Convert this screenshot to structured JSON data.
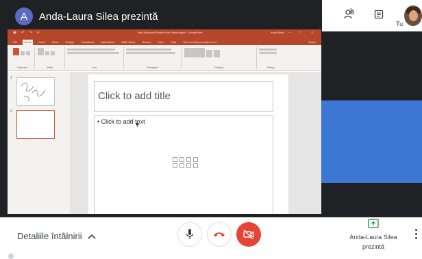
{
  "presenter": {
    "avatar_letter": "A",
    "title": "Anda-Laura Silea prezintă",
    "avatar_color": "#5c6bc0"
  },
  "top_right": {
    "people_count": "3",
    "you_label": "Tu",
    "icons": [
      "people-icon",
      "chat-icon"
    ]
  },
  "powerpoint": {
    "window_title": "New Microsoft PowerPoint Presentation - PowerPoint",
    "user": "Anda Silea",
    "tabs": [
      "File",
      "Home",
      "Insert",
      "Draw",
      "Design",
      "Transitions",
      "Animations",
      "Slide Show",
      "Review",
      "View",
      "Help",
      "Tell me what you want to do"
    ],
    "share_label": "Share",
    "ribbon_groups": [
      "Clipboard",
      "Slides",
      "Font",
      "Paragraph",
      "Drawing",
      "Editing"
    ],
    "thumbnails": [
      {
        "number": "1"
      },
      {
        "number": "2"
      }
    ],
    "slide": {
      "title_placeholder": "Click to add title",
      "body_placeholder": "• Click to add text"
    },
    "accent": "#b7472a"
  },
  "bottom_bar": {
    "meeting_details": "Detaliile întâlnirii",
    "presenting_label_line1": "Anda-Laura Silea",
    "presenting_label_line2": "prezintă"
  },
  "colors": {
    "stage_bg": "#202124",
    "participant_tile": "#3c77d4",
    "camera_off": "#ea4335",
    "hangup_icon": "#ea4335",
    "present_icon": "#1e8e3e"
  }
}
